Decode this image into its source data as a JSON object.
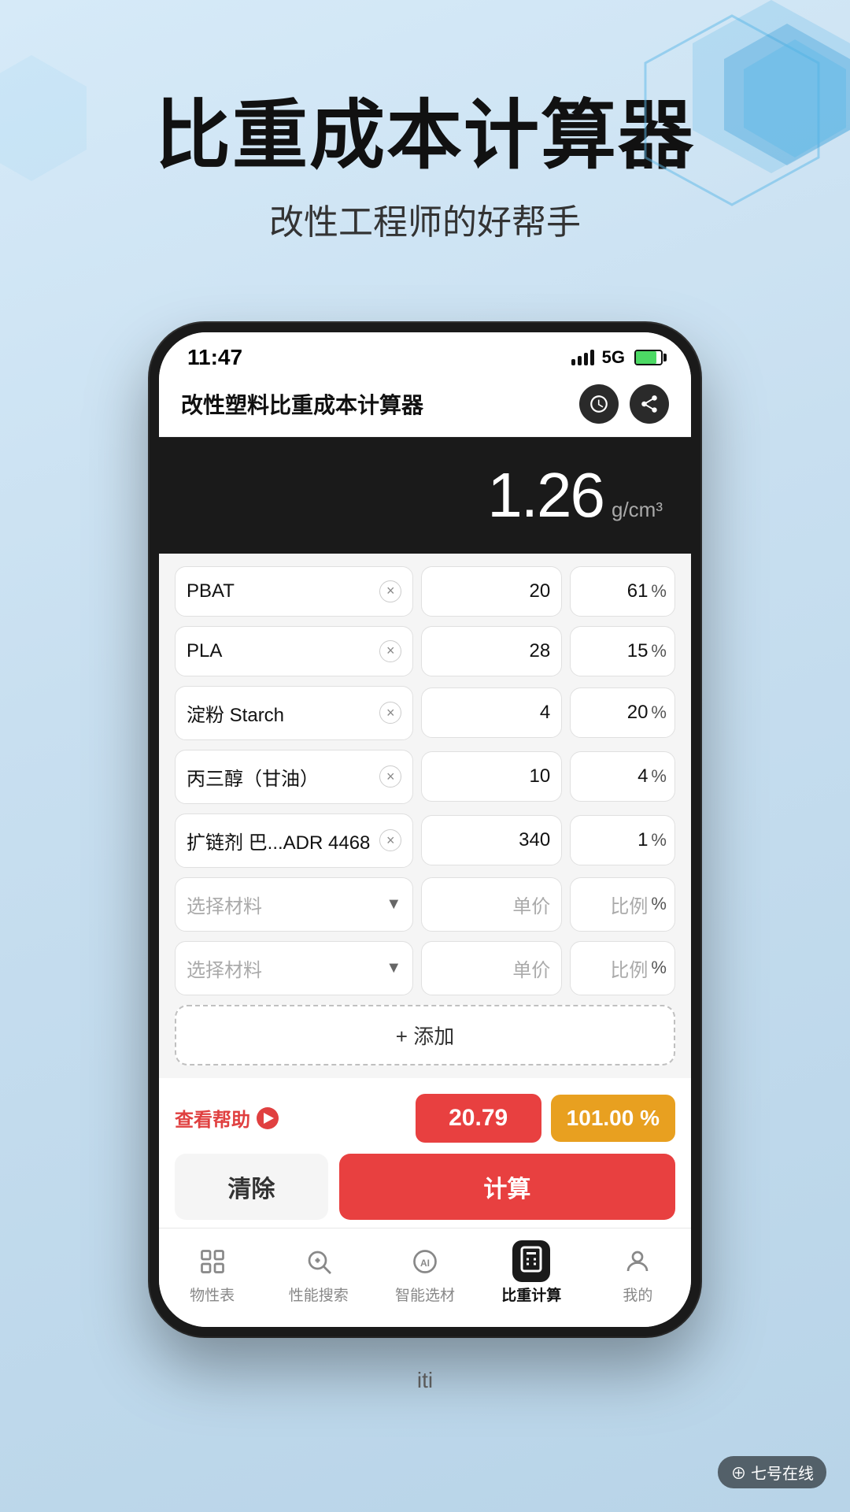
{
  "page": {
    "background": "#c8dff0"
  },
  "header": {
    "main_title": "比重成本计算器",
    "sub_title": "改性工程师的好帮手"
  },
  "phone": {
    "status_bar": {
      "time": "11:47",
      "signal": "5G",
      "battery": "80"
    },
    "app_title": "改性塑料比重成本计算器",
    "result": {
      "value": "1.26",
      "unit": "g/cm³"
    },
    "materials": [
      {
        "name": "PBAT",
        "price": "20",
        "percent": "61"
      },
      {
        "name": "PLA",
        "price": "28",
        "percent": "15"
      },
      {
        "name": "淀粉 Starch",
        "price": "4",
        "percent": "20"
      },
      {
        "name": "丙三醇（甘油）",
        "price": "10",
        "percent": "4"
      },
      {
        "name": "扩链剂 巴...ADR 4468",
        "price": "340",
        "percent": "1"
      }
    ],
    "select_rows": [
      {
        "placeholder_name": "选择材料",
        "placeholder_price": "单价",
        "placeholder_pct": "比例"
      },
      {
        "placeholder_name": "选择材料",
        "placeholder_price": "单价",
        "placeholder_pct": "比例"
      }
    ],
    "add_button": "+ 添加",
    "help_label": "查看帮助",
    "result_price": "20.79",
    "result_pct": "101.00 %",
    "clear_label": "清除",
    "calc_label": "计算",
    "tabs": [
      {
        "id": "properties",
        "label": "物性表",
        "active": false
      },
      {
        "id": "search",
        "label": "性能搜索",
        "active": false
      },
      {
        "id": "ai",
        "label": "智能选材",
        "active": false
      },
      {
        "id": "calc",
        "label": "比重计算",
        "active": true
      },
      {
        "id": "mine",
        "label": "我的",
        "active": false
      }
    ]
  },
  "bottom_label": "iti",
  "watermark": "⊕ 七号在线"
}
